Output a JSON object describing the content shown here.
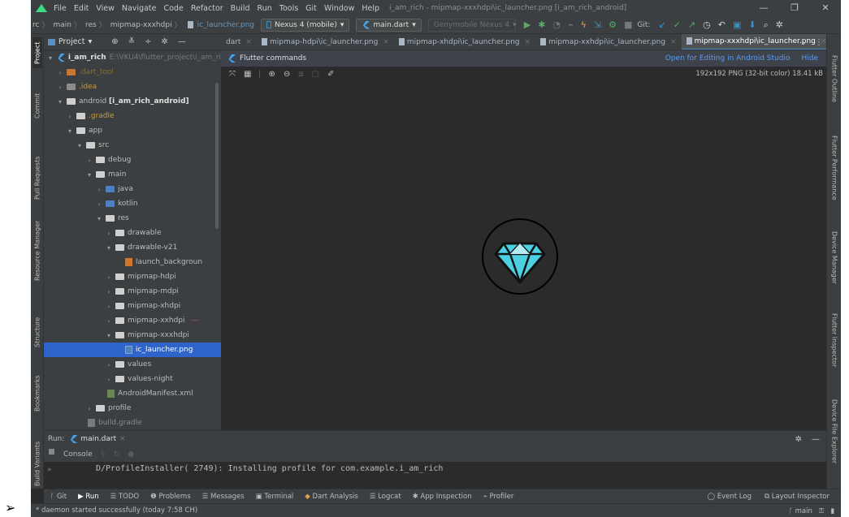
{
  "window": {
    "menu": [
      "File",
      "Edit",
      "View",
      "Navigate",
      "Code",
      "Refactor",
      "Build",
      "Run",
      "Tools",
      "Git",
      "Window",
      "Help"
    ],
    "title": "i_am_rich - mipmap-xxxhdpi\\ic_launcher.png [i_am_rich_android]",
    "minimize_icon": "—",
    "restore_icon": "❐",
    "close_icon": "✕"
  },
  "nav": {
    "crumbs": [
      "rc",
      "main",
      "res",
      "mipmap-xxxhdpi"
    ],
    "file": "ic_launcher.png",
    "device": "Nexus 4 (mobile)",
    "run_config": "main.dart",
    "emulator": "Genymobile Nexus 4",
    "git_label": "Git:"
  },
  "left_stripe": [
    "Project",
    "Commit",
    "Pull Requests",
    "Resource Manager",
    "Structure",
    "Bookmarks",
    "Build Variants"
  ],
  "right_stripe": [
    "Flutter Outline",
    "Flutter Performance",
    "Device Manager",
    "Flutter Inspector",
    "Device File Explorer"
  ],
  "project": {
    "title": "Project",
    "tree": [
      {
        "label": "i_am_rich",
        "muted": "E:\\VKU4\\flutter_project\\i_am_ri"
      },
      {
        "label": ".dart_tool"
      },
      {
        "label": ".idea"
      },
      {
        "label": "android",
        "bold": "[i_am_rich_android]"
      },
      {
        "label": ".gradle"
      },
      {
        "label": "app"
      },
      {
        "label": "src"
      },
      {
        "label": "debug"
      },
      {
        "label": "main"
      },
      {
        "label": "java"
      },
      {
        "label": "kotlin"
      },
      {
        "label": "res"
      },
      {
        "label": "drawable"
      },
      {
        "label": "drawable-v21"
      },
      {
        "label": "launch_backgroun"
      },
      {
        "label": "mipmap-hdpi"
      },
      {
        "label": "mipmap-mdpi"
      },
      {
        "label": "mipmap-xhdpi"
      },
      {
        "label": "mipmap-xxhdpi"
      },
      {
        "label": "mipmap-xxxhdpi"
      },
      {
        "label": "ic_launcher.png"
      },
      {
        "label": "values"
      },
      {
        "label": "values-night"
      },
      {
        "label": "AndroidManifest.xml"
      },
      {
        "label": "profile"
      },
      {
        "label": "build.gradle"
      }
    ]
  },
  "tabs": [
    {
      "label": "dart"
    },
    {
      "label": "mipmap-hdpi\\ic_launcher.png"
    },
    {
      "label": "mipmap-xhdpi\\ic_launcher.png"
    },
    {
      "label": "mipmap-xxhdpi\\ic_launcher.png"
    },
    {
      "label": "mipmap-xxxhdpi\\ic_launcher.png"
    }
  ],
  "banner": {
    "text": "Flutter commands",
    "open_link": "Open for Editing in Android Studio",
    "hide_link": "Hide"
  },
  "image_info": "192x192 PNG (32-bit color) 18.41 kB",
  "run": {
    "label": "Run:",
    "tab": "main.dart",
    "console_label": "Console",
    "log": "D/ProfileInstaller( 2749): Installing profile for com.example.i_am_rich"
  },
  "bottom_tabs": [
    "Git",
    "Run",
    "TODO",
    "Problems",
    "Messages",
    "Terminal",
    "Dart Analysis",
    "Logcat",
    "App Inspection",
    "Profiler"
  ],
  "bottom_right": [
    "Event Log",
    "Layout Inspector"
  ],
  "status": {
    "message": "* daemon started successfully (today 7:58 CH)",
    "branch": "main"
  },
  "colors": {
    "accent": "#2f65ca",
    "link": "#589df6",
    "diamond": "#4dd0e1"
  }
}
